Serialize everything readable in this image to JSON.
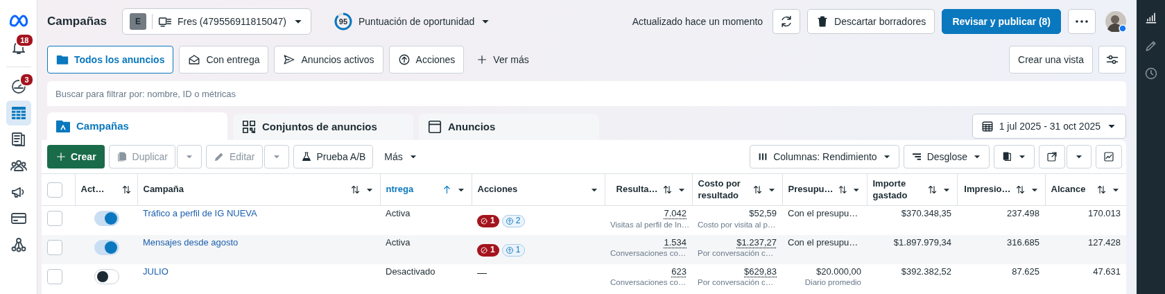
{
  "sidebar": {
    "top": [
      {
        "kind": "logo",
        "selected": false
      },
      {
        "kind": "bell",
        "badge": "18",
        "selected": false
      }
    ],
    "items": [
      {
        "kind": "gauge",
        "badge": "3",
        "selected": false
      },
      {
        "kind": "table",
        "selected": true
      },
      {
        "kind": "pages",
        "selected": false
      },
      {
        "kind": "people",
        "selected": false
      },
      {
        "kind": "megaphone",
        "selected": false
      },
      {
        "kind": "card",
        "selected": false
      },
      {
        "kind": "network",
        "selected": false
      }
    ]
  },
  "right_rail": {
    "items": [
      {
        "kind": "chart",
        "selected": true
      },
      {
        "kind": "pencil",
        "selected": false
      },
      {
        "kind": "clock",
        "selected": false
      }
    ]
  },
  "header": {
    "title": "Campañas",
    "account": {
      "letter": "E",
      "name": "Fres (479556911815047)"
    },
    "score": {
      "value": "95",
      "label": "Puntuación de oportunidad"
    },
    "updated": "Actualizado hace un momento",
    "discard": "Descartar borradores",
    "publish": "Revisar y publicar (8)"
  },
  "filters": [
    {
      "label": "Todos los anuncios",
      "selected": true
    },
    {
      "label": "Con entrega",
      "selected": false
    },
    {
      "label": "Anuncios activos",
      "selected": false
    },
    {
      "label": "Acciones",
      "selected": false
    }
  ],
  "see_more": "Ver más",
  "create_view": "Crear una vista",
  "search": {
    "placeholder": "Buscar para filtrar por: nombre, ID o métricas"
  },
  "level_tabs": [
    {
      "label": "Campañas",
      "selected": true
    },
    {
      "label": "Conjuntos de anuncios",
      "selected": false
    },
    {
      "label": "Anuncios",
      "selected": false
    }
  ],
  "date_range": "1 jul 2025 - 31 oct 2025",
  "toolbar": {
    "create": "Crear",
    "duplicate": {
      "label": "Duplicar",
      "disabled": true
    },
    "edit": {
      "label": "Editar",
      "disabled": true
    },
    "ab_test": "Prueba A/B",
    "more": "Más",
    "columns": "Columnas: Rendimiento",
    "breakdown": "Desglose"
  },
  "table": {
    "select_all_checked": false,
    "columns": [
      {
        "label": "Act…",
        "sortable": true,
        "right_aligned": false,
        "menu": false,
        "sorted": false
      },
      {
        "label": "Campaña",
        "sortable": true,
        "right_aligned": false,
        "menu": true,
        "sorted": false
      },
      {
        "label": "ntrega",
        "sortable": true,
        "right_aligned": false,
        "menu": true,
        "sorted": true
      },
      {
        "label": "Acciones",
        "sortable": false,
        "right_aligned": false,
        "menu": true,
        "sorted": false
      },
      {
        "label": "Resulta…",
        "sortable": true,
        "right_aligned": true,
        "menu": true,
        "sorted": false
      },
      {
        "label": "Costo por resultado",
        "sortable": true,
        "right_aligned": false,
        "menu": true,
        "sorted": false
      },
      {
        "label": "Presupu…",
        "sortable": true,
        "right_aligned": false,
        "menu": true,
        "sorted": false
      },
      {
        "label": "Importe gastado",
        "sortable": true,
        "right_aligned": false,
        "menu": true,
        "sorted": false
      },
      {
        "label": "Impresio…",
        "sortable": true,
        "right_aligned": true,
        "menu": true,
        "sorted": false
      },
      {
        "label": "Alcance",
        "sortable": true,
        "right_aligned": false,
        "menu": true,
        "sorted": false
      }
    ],
    "rows": [
      {
        "checked": false,
        "on": true,
        "name": "Tráfico a perfil de IG NUEVA",
        "delivery": "Activa",
        "actions": {
          "kind": "badges",
          "errors": "1",
          "pending": "2"
        },
        "results": {
          "value": "7.042",
          "label": "Visitas al perfil de In…",
          "dotted": true
        },
        "cost": {
          "value": "$52,59",
          "label": "Costo por visita al p…",
          "dotted": false
        },
        "budget": {
          "kind": "text",
          "value": "Con el presupu…"
        },
        "spent": "$370.348,35",
        "impressions": "237.498",
        "reach": "170.013"
      },
      {
        "checked": false,
        "on": true,
        "name": "Mensajes desde agosto",
        "delivery": "Activa",
        "actions": {
          "kind": "badges",
          "errors": "1",
          "pending": "1"
        },
        "results": {
          "value": "1.534",
          "label": "Conversaciones co…",
          "dotted": true
        },
        "cost": {
          "value": "$1.237,27",
          "label": "Por conversación c…",
          "dotted": true
        },
        "budget": {
          "kind": "text",
          "value": "Con el presupu…"
        },
        "spent": "$1.897.979,34",
        "impressions": "316.685",
        "reach": "127.428"
      },
      {
        "checked": false,
        "on": false,
        "name": "JULIO",
        "delivery": "Desactivado",
        "actions": {
          "kind": "text",
          "text": "—"
        },
        "results": {
          "value": "623",
          "label": "Conversaciones co…",
          "dotted": true
        },
        "cost": {
          "value": "$629,83",
          "label": "Por conversación c…",
          "dotted": true
        },
        "budget": {
          "kind": "amount",
          "value": "$20.000,00",
          "sub": "Diario promedio"
        },
        "spent": "$392.382,52",
        "impressions": "87.625",
        "reach": "47.631"
      }
    ]
  }
}
